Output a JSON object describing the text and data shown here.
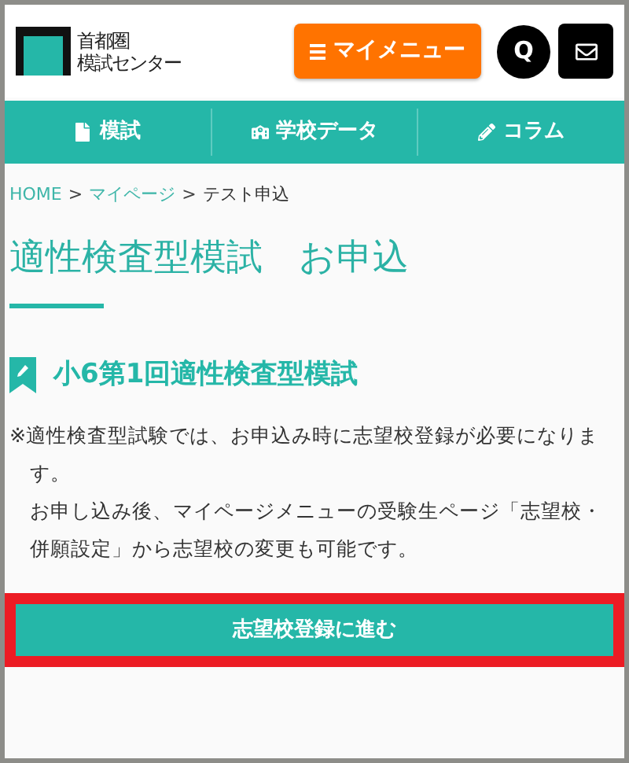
{
  "header": {
    "logo_lines": [
      "首都圏",
      "模試センター"
    ],
    "menu_button": "マイメニュー",
    "q_button": "Q"
  },
  "nav": [
    {
      "label": "模試"
    },
    {
      "label": "学校データ"
    },
    {
      "label": "コラム"
    }
  ],
  "breadcrumb": [
    {
      "label": "HOME",
      "link": true
    },
    {
      "label": "マイページ",
      "link": true
    },
    {
      "label": "テスト申込",
      "link": false
    }
  ],
  "breadcrumb_separator": ">",
  "title": "適性検査型模試　お申込",
  "subtitle": "小6第1回適性検査型模試",
  "notes": [
    "※適性検査型試験では、お申込み時に志望校登録が必要になります。",
    "お申し込み後、マイページメニューの受験生ページ「志望校・併願設定」から志望校の変更も可能です。"
  ],
  "action_button": {
    "label": "志望校登録に進む",
    "highlighted": true
  }
}
